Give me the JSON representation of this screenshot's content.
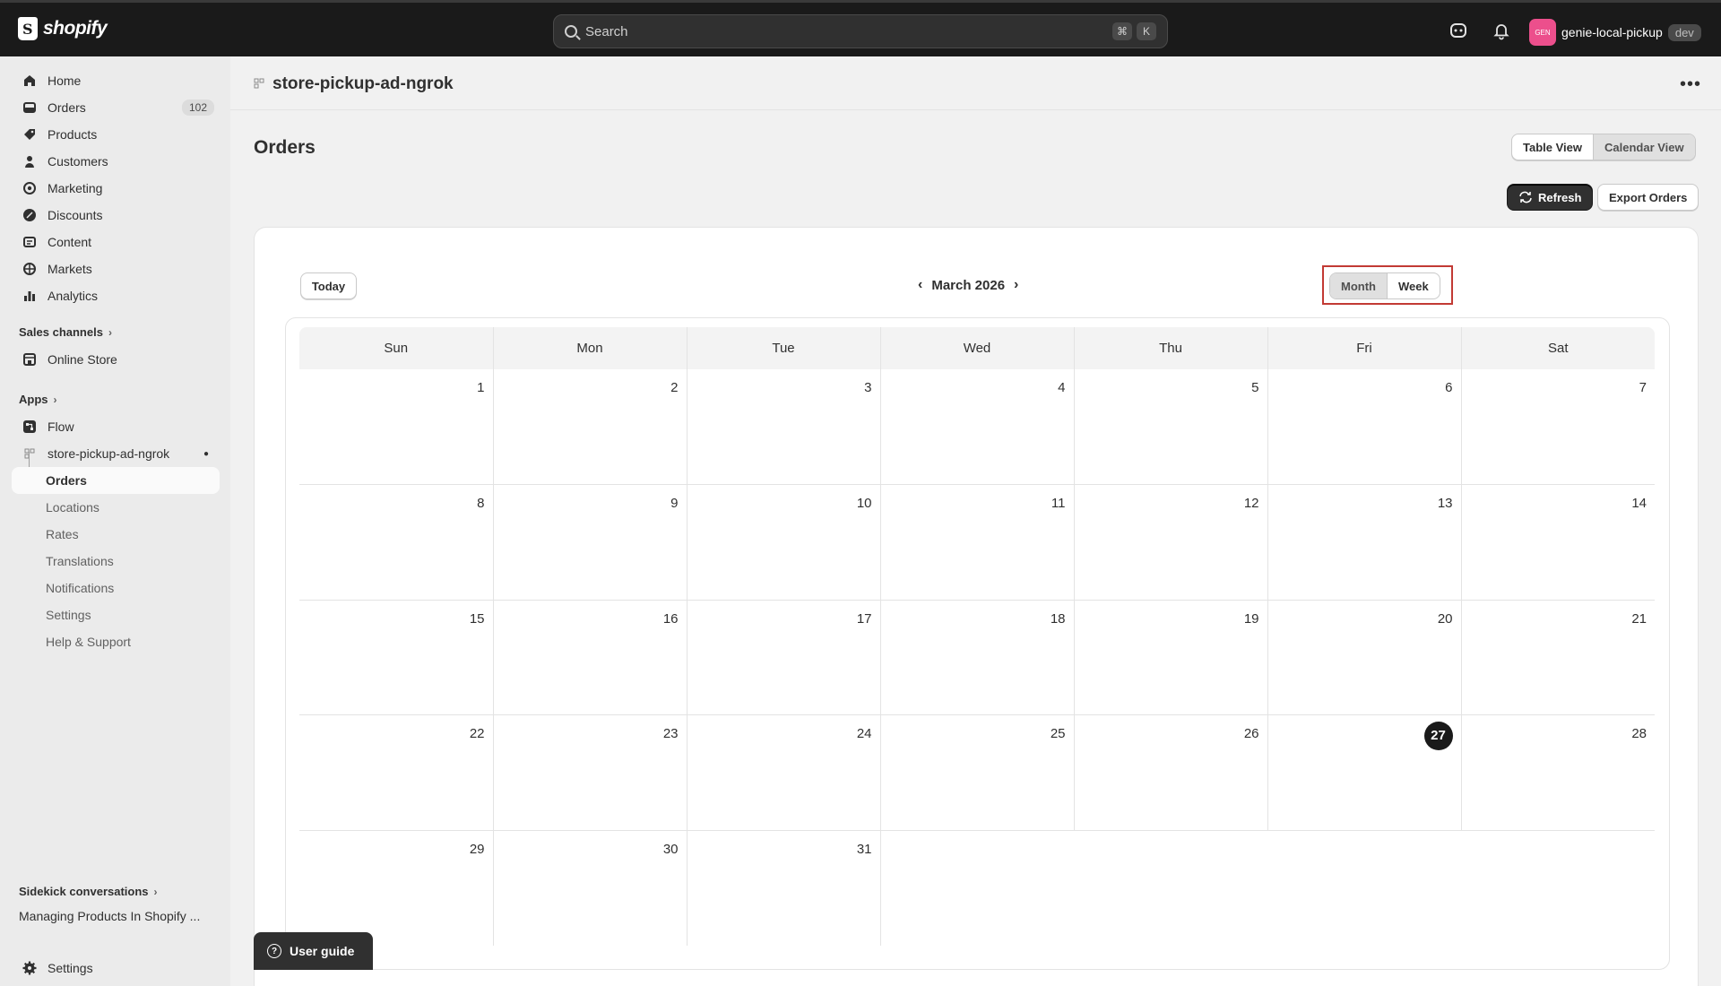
{
  "topbar": {
    "logo_text": "shopify",
    "search_placeholder": "Search",
    "shortcut_keys": [
      "⌘",
      "K"
    ],
    "store_avatar_text": "GEN",
    "store_name": "genie-local-pickup",
    "store_badge": "dev",
    "icons": [
      "sidekick-icon",
      "bell-icon"
    ]
  },
  "sidebar": {
    "items": [
      {
        "label": "Home",
        "icon": "home-icon"
      },
      {
        "label": "Orders",
        "icon": "orders-icon",
        "badge": "102"
      },
      {
        "label": "Products",
        "icon": "tag-icon"
      },
      {
        "label": "Customers",
        "icon": "person-icon"
      },
      {
        "label": "Marketing",
        "icon": "target-icon"
      },
      {
        "label": "Discounts",
        "icon": "discount-icon"
      },
      {
        "label": "Content",
        "icon": "content-icon"
      },
      {
        "label": "Markets",
        "icon": "globe-icon"
      },
      {
        "label": "Analytics",
        "icon": "bar-chart-icon"
      }
    ],
    "sales_channels_label": "Sales channels",
    "online_store_label": "Online Store",
    "apps_label": "Apps",
    "flow_label": "Flow",
    "app_name": "store-pickup-ad-ngrok",
    "app_subitems": [
      "Orders",
      "Locations",
      "Rates",
      "Translations",
      "Notifications",
      "Settings",
      "Help & Support"
    ],
    "sidekick_label": "Sidekick conversations",
    "sidekick_item": "Managing Products In Shopify ...",
    "settings_label": "Settings"
  },
  "app_header": {
    "title": "store-pickup-ad-ngrok",
    "more_label": "•••"
  },
  "page": {
    "title": "Orders",
    "view_options": [
      "Table View",
      "Calendar View"
    ],
    "selected_view": "Calendar View",
    "refresh_label": "Refresh",
    "export_label": "Export Orders"
  },
  "calendar": {
    "today_label": "Today",
    "month_label": "March 2026",
    "mode_options": [
      "Month",
      "Week"
    ],
    "selected_mode": "Month",
    "weekdays": [
      "Sun",
      "Mon",
      "Tue",
      "Wed",
      "Thu",
      "Fri",
      "Sat"
    ],
    "weeks": [
      [
        "1",
        "2",
        "3",
        "4",
        "5",
        "6",
        "7"
      ],
      [
        "8",
        "9",
        "10",
        "11",
        "12",
        "13",
        "14"
      ],
      [
        "15",
        "16",
        "17",
        "18",
        "19",
        "20",
        "21"
      ],
      [
        "22",
        "23",
        "24",
        "25",
        "26",
        "27",
        "28"
      ],
      [
        "29",
        "30",
        "31",
        "",
        "",
        "",
        ""
      ]
    ],
    "today_date": "27"
  },
  "user_guide_label": "User guide",
  "colors": {
    "topbar": "#1a1a1a",
    "highlight_box": "#c23a34",
    "store_avatar": "#ec4f8c"
  }
}
